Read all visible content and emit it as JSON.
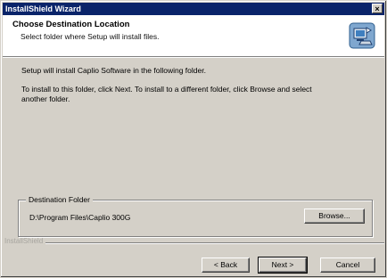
{
  "window": {
    "title": "InstallShield Wizard",
    "close_glyph": "×"
  },
  "header": {
    "title": "Choose Destination Location",
    "subtitle": "Select folder where Setup will install files.",
    "icon": "setup-computer-icon"
  },
  "body": {
    "line1": "Setup will install Caplio Software in the following folder.",
    "line2": "To install to this folder, click Next. To install to a different folder, click Browse and select",
    "line3": "another folder."
  },
  "destination": {
    "group_label": "Destination Folder",
    "path": "D:\\Program Files\\Caplio 300G",
    "browse_label": "Browse..."
  },
  "brand": "InstallShield",
  "buttons": {
    "back_label": "< Back",
    "next_label": "Next >",
    "cancel_label": "Cancel"
  }
}
